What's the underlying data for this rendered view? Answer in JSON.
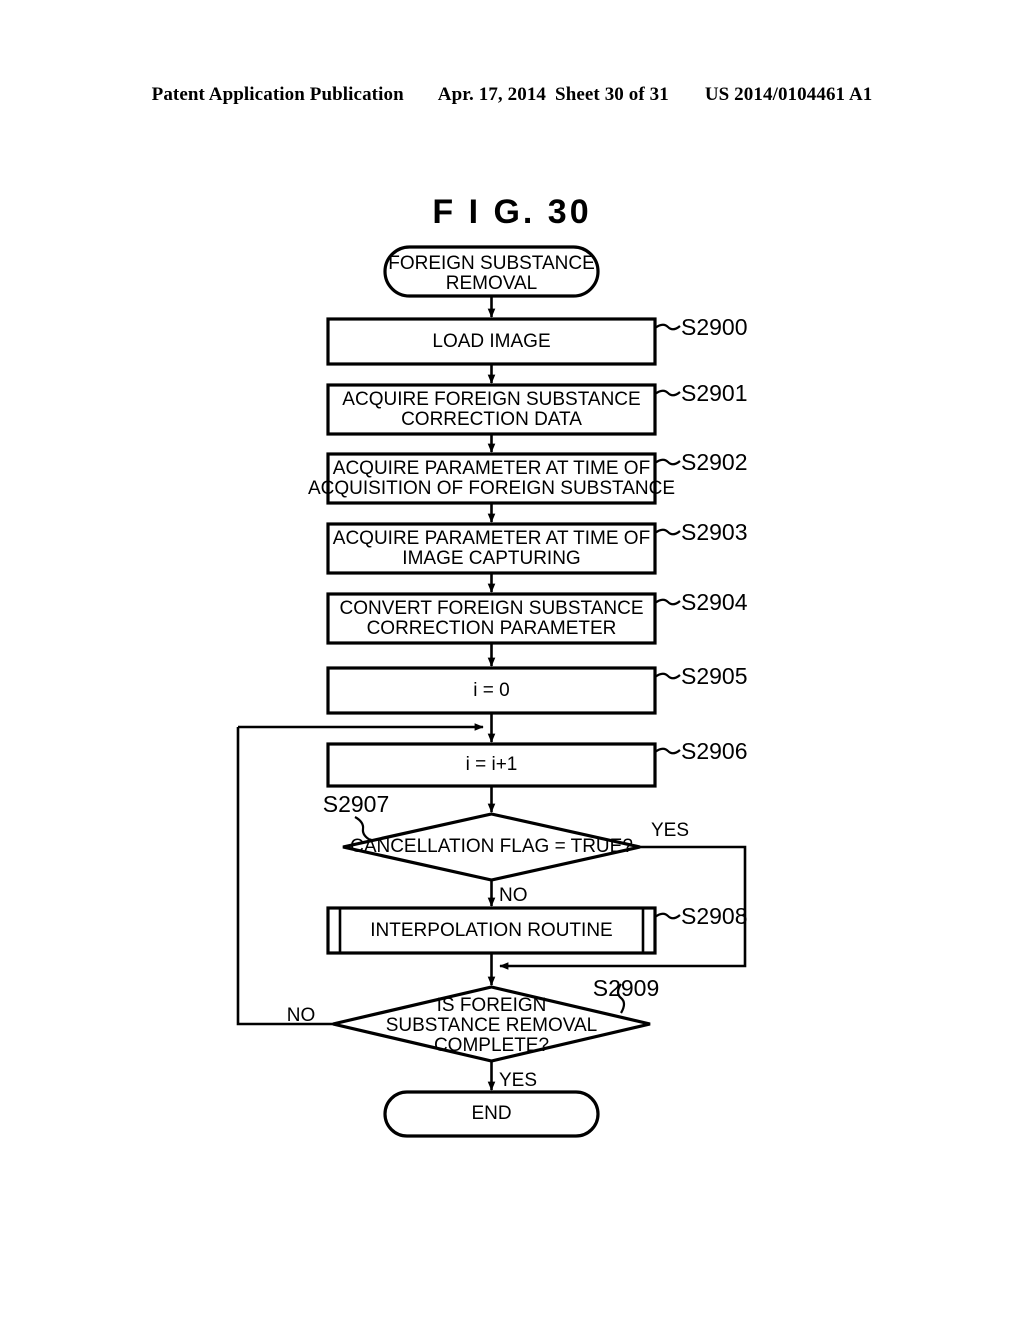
{
  "header": {
    "publication": "Patent Application Publication",
    "date": "Apr. 17, 2014",
    "sheet": "Sheet 30 of 31",
    "number": "US 2014/0104461 A1"
  },
  "figure": {
    "title": "F I G.  30"
  },
  "flowchart": {
    "start": {
      "label": "FOREIGN SUBSTANCE\nREMOVAL",
      "line1": "FOREIGN SUBSTANCE",
      "line2": "REMOVAL"
    },
    "end": {
      "label": "END"
    },
    "steps": [
      {
        "id": "S2900",
        "line1": "LOAD IMAGE",
        "line2": "",
        "type": "process"
      },
      {
        "id": "S2901",
        "line1": "ACQUIRE FOREIGN SUBSTANCE",
        "line2": "CORRECTION DATA",
        "type": "process"
      },
      {
        "id": "S2902",
        "line1": "ACQUIRE PARAMETER AT TIME OF",
        "line2": "ACQUISITION OF FOREIGN SUBSTANCE",
        "type": "process"
      },
      {
        "id": "S2903",
        "line1": "ACQUIRE PARAMETER AT TIME OF",
        "line2": "IMAGE CAPTURING",
        "type": "process"
      },
      {
        "id": "S2904",
        "line1": "CONVERT FOREIGN SUBSTANCE",
        "line2": "CORRECTION PARAMETER",
        "type": "process"
      },
      {
        "id": "S2905",
        "line1": "i = 0",
        "line2": "",
        "type": "process"
      },
      {
        "id": "S2906",
        "line1": "i = i+1",
        "line2": "",
        "type": "process"
      },
      {
        "id": "S2907",
        "line1": "CANCELLATION FLAG = TRUE?",
        "line2": "",
        "line3": "",
        "type": "decision"
      },
      {
        "id": "S2908",
        "line1": "INTERPOLATION ROUTINE",
        "line2": "",
        "type": "subroutine"
      },
      {
        "id": "S2909",
        "line1": "IS FOREIGN",
        "line2": "SUBSTANCE REMOVAL",
        "line3": "COMPLETE?",
        "type": "decision"
      }
    ],
    "branch_labels": {
      "s2907_yes": "YES",
      "s2907_no": "NO",
      "s2909_no": "NO",
      "s2909_yes": "YES"
    }
  },
  "colors": {
    "ink": "#000000",
    "paper": "#ffffff"
  }
}
